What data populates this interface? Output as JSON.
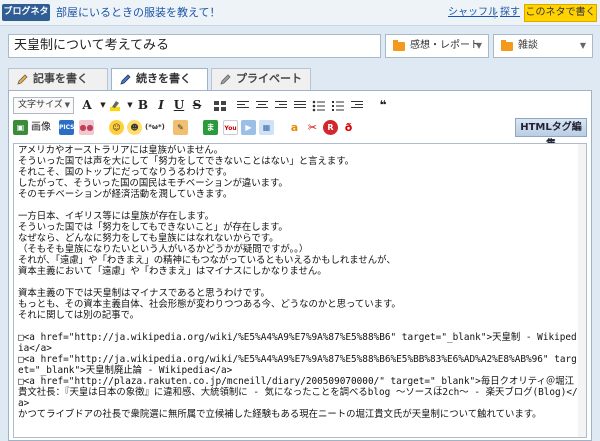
{
  "topbar": {
    "badge": "ブログネタ",
    "topic": "部屋にいるときの服装を教えて！",
    "shuffle": "シャッフル",
    "separator": "|",
    "search": "探す",
    "use_topic": "このネタで書く"
  },
  "title": {
    "value": "天皇制について考えてみる"
  },
  "categories": {
    "genre": "感想・レポート",
    "category": "雑談"
  },
  "tabs": [
    {
      "label": "記事を書く"
    },
    {
      "label": "続きを書く"
    },
    {
      "label": "プライベート"
    }
  ],
  "toolbar": {
    "font_size": "文字サイズ",
    "bold": "B",
    "italic": "I",
    "underline": "U",
    "strike": "S",
    "image": "画像",
    "html_edit": "HTMLタグ編集"
  },
  "icons": {
    "text_color": "text-color-icon",
    "highlight": "highlight-icon",
    "quote": "quote-icon"
  },
  "body": {
    "text": "アメリカやオーストラリアには皇族がいません。\nそういった国では声を大にして「努力をしてできないことはない」と言えます。\nそれこそ、国のトップにだってなりうるわけです。\nしたがって、そういった国の国民はモチベーションが違います。\nそのモチベーションが経済活動を潤していきます。\n\n一方日本、イギリス等には皇族が存在します。\nそういった国では「努力をしてもできないこと」が存在します。\nなぜなら、どんなに努力をしても皇族にはなれないからです。\n（そもそも皇族になりたいという人がいるかどうかが疑問ですが。。）\nそれが、「遠慮」や「わきまえ」の精神にもつながっているともいえるかもしれませんが、\n資本主義において「遠慮」や「わきまえ」はマイナスにしかなりません。\n\n資本主義の下では天皇制はマイナスであると思うわけです。\nもっとも、その資本主義自体、社会形態が変わりつつある今、どうなのかと思っています。\nそれに関しては別の記事で。\n\n□<a href=\"http://ja.wikipedia.org/wiki/%E5%A4%A9%E7%9A%87%E5%88%B6\" target=\"_blank\">天皇制 - Wikipedia</a>\n□<a href=\"http://ja.wikipedia.org/wiki/%E5%A4%A9%E7%9A%87%E5%88%B6%E5%BB%83%E6%AD%A2%E8%AB%96\" target=\"_blank\">天皇制廃止論 - Wikipedia</a>\n□<a href=\"http://plaza.rakuten.co.jp/mcneill/diary/200509070000/\" target=\"_blank\">毎日クオリティ＠堀江貴文社長：『天皇は日本の象徴』に違和感、大統領制に - 気になったことを調べるblog ～ソースは2ch～ - 楽天ブログ(Blog)</a>\nかつてライブドアの社長で衆院選に無所属で立候補した経験もある現在ニートの堀江貴文氏が天皇制について触れています。"
  }
}
